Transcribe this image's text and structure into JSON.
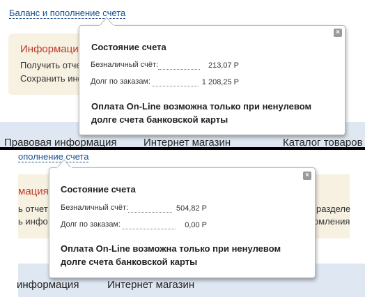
{
  "screens": [
    {
      "top_link": "Баланс и пополнение счета",
      "info_title": "Информация",
      "info_lines": [
        "Получить отчет",
        "Сохранить инфо"
      ],
      "nav": [
        "Правовая информация",
        "Интернет магазин",
        "Каталог товаров"
      ],
      "popup": {
        "title": "Состояние счета",
        "rows": [
          {
            "label": "Безналичный счёт:",
            "value": "213,07 Р"
          },
          {
            "label": "Долг по заказам:",
            "value": "1 208,25 Р"
          }
        ],
        "note": "Оплата On-Line возможна только при ненулевом долге счета банковской карты",
        "close_icon": "×"
      }
    },
    {
      "top_link": "ополнение счета",
      "info_title": "мация",
      "info_lines": [
        "ь отчет",
        "ь инфо"
      ],
      "right_lines": [
        "разделе",
        "омления"
      ],
      "nav": [
        "информация",
        "Интернет магазин"
      ],
      "popup": {
        "title": "Состояние счета",
        "rows": [
          {
            "label": "Безналичный счёт:",
            "value": "504,82 Р"
          },
          {
            "label": "Долг по заказам:",
            "value": "0,00 Р"
          }
        ],
        "note": "Оплата On-Line возможна только при ненулевом долге счета банковской карты",
        "close_icon": "×"
      }
    }
  ]
}
